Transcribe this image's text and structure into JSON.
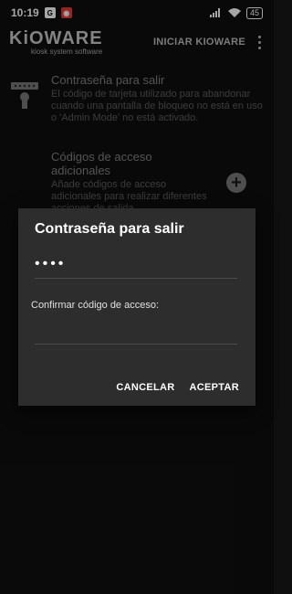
{
  "status_bar": {
    "time": "10:19",
    "battery": "45",
    "left_icons": [
      "google-icon",
      "alarm-icon"
    ],
    "right_icons": [
      "signal-icon",
      "wifi-icon",
      "battery-icon"
    ]
  },
  "app_bar": {
    "logo_main": "KiOWARE",
    "logo_sub": "kiosk system software",
    "action": "INICIAR KIOWARE"
  },
  "settings": [
    {
      "title": "Contraseña para salir",
      "description": "El código de tarjeta utilizado para abandonar cuando una pantalla de bloqueo no está en uso o 'Admin Mode' no está activado.",
      "icon": "keypad-lock-icon"
    },
    {
      "title": "Códigos de acceso adicionales",
      "description": "Añade códigos de acceso adicionales para realizar diferentes acciones de salida.",
      "icon": "add-circle-icon"
    }
  ],
  "dialog": {
    "title": "Contraseña para salir",
    "password_value": "••••",
    "confirm_label": "Confirmar código de acceso:",
    "confirm_value": "",
    "cancel_label": "CANCELAR",
    "accept_label": "ACEPTAR"
  },
  "colors": {
    "background": "#0f0f0f",
    "dialog_bg": "#2d2d2d",
    "text": "#ffffff",
    "muted": "#9a9a9a"
  }
}
